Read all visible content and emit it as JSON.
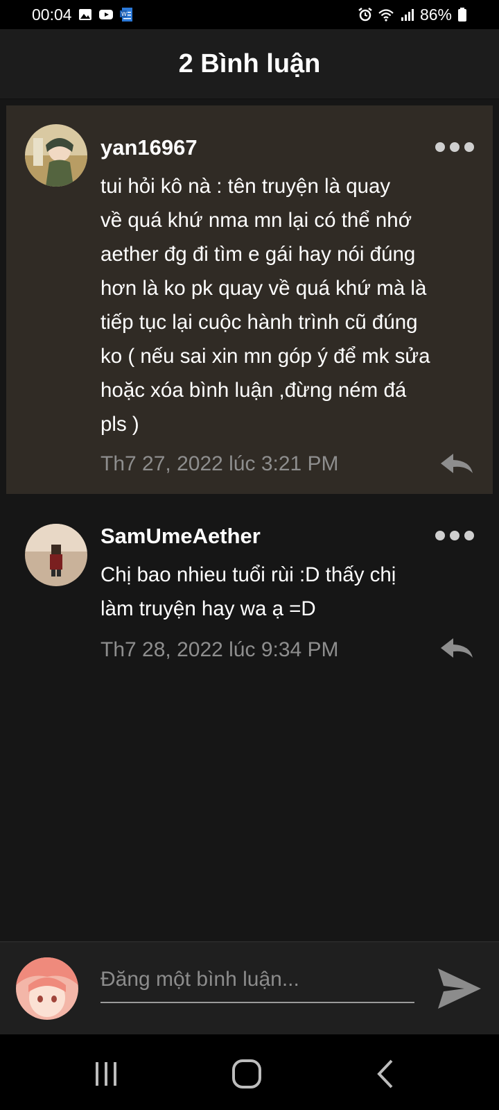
{
  "status_bar": {
    "time": "00:04",
    "battery": "86%",
    "icons": [
      "gallery-icon",
      "youtube-icon",
      "word-doc-icon",
      "alarm-icon",
      "wifi-icon",
      "signal-icon",
      "battery-icon"
    ]
  },
  "header": {
    "title": "2 Bình luận"
  },
  "comments": [
    {
      "username": "yan16967",
      "text": "tui hỏi kô nà : tên truyện là quay\nvề quá khứ nma mn lại có thể nhớ\naether đg đi tìm e gái hay nói đúng\nhơn là ko pk quay về quá khứ mà là\ntiếp tục lại cuộc hành trình cũ đúng\nko ( nếu sai xin mn  góp ý để mk sửa\nhoặc xóa bình luận ,đừng ném đá\npls )",
      "timestamp": "Th7 27, 2022 lúc 3:21 PM",
      "highlighted": true
    },
    {
      "username": "SamUmeAether",
      "text": "Chị bao nhieu tuổi rùi :D thấy chị\nlàm truyện hay wa ạ =D",
      "timestamp": "Th7 28, 2022 lúc 9:34 PM",
      "highlighted": false
    }
  ],
  "composer": {
    "placeholder": "Đăng một bình luận..."
  },
  "colors": {
    "background": "#161616",
    "highlight": "#302b25",
    "header": "#1c1c1c",
    "muted_text": "#8e8e8e"
  }
}
